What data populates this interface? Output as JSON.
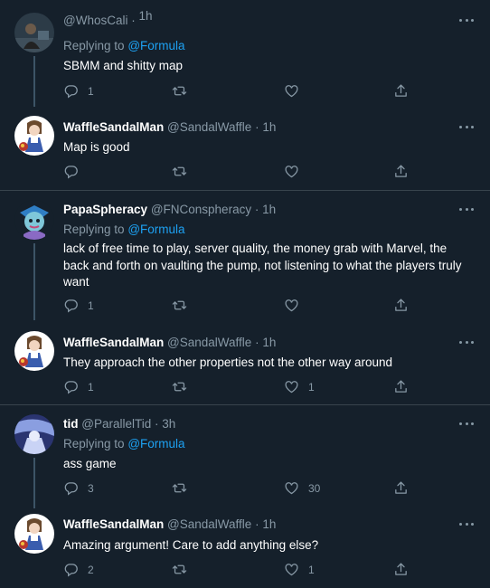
{
  "colors": {
    "background": "#15202b",
    "divider": "#38444d",
    "muted": "#8899a6",
    "link": "#1da1f2"
  },
  "icons": [
    "reply-icon",
    "retweet-icon",
    "like-icon",
    "share-icon",
    "more-icon"
  ],
  "tweets": [
    {
      "display_name": "",
      "handle": "@WhosCali",
      "sep": "·",
      "time": "1h",
      "replying_label": "Replying to",
      "replying_handle": "@Formula",
      "text": "SBMM and shitty map",
      "replies": "1",
      "retweets": "",
      "likes": ""
    },
    {
      "display_name": "WaffleSandalMan",
      "handle": "@SandalWaffle",
      "sep": "·",
      "time": "1h",
      "text": "Map is good",
      "replies": "",
      "retweets": "",
      "likes": ""
    },
    {
      "display_name": "PapaSpheracy",
      "handle": "@FNConspheracy",
      "sep": "·",
      "time": "1h",
      "replying_label": "Replying to",
      "replying_handle": "@Formula",
      "text": "lack of free time to play, server quality, the money grab with Marvel, the back and forth on vaulting the pump, not listening to what the players truly want",
      "replies": "1",
      "retweets": "",
      "likes": ""
    },
    {
      "display_name": "WaffleSandalMan",
      "handle": "@SandalWaffle",
      "sep": "·",
      "time": "1h",
      "text": "They approach the other properties not the other way around",
      "replies": "1",
      "retweets": "",
      "likes": "1"
    },
    {
      "display_name": "tid",
      "handle": "@ParallelTid",
      "sep": "·",
      "time": "3h",
      "replying_label": "Replying to",
      "replying_handle": "@Formula",
      "text": "ass game",
      "replies": "3",
      "retweets": "",
      "likes": "30"
    },
    {
      "display_name": "WaffleSandalMan",
      "handle": "@SandalWaffle",
      "sep": "·",
      "time": "1h",
      "text": "Amazing argument! Care to add anything else?",
      "replies": "2",
      "retweets": "",
      "likes": "1"
    }
  ]
}
